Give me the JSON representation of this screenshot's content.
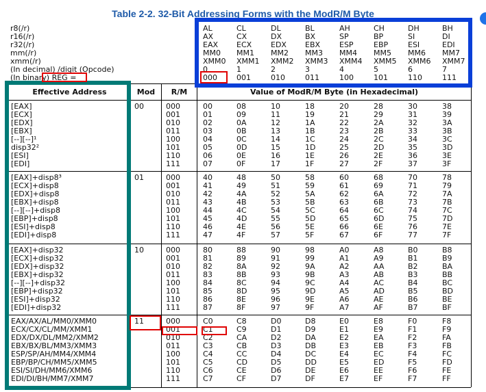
{
  "title": "Table 2-2.  32-Bit Addressing Forms with the ModR/M Byte",
  "left_labels": [
    "r8(/r)",
    "r16(/r)",
    "r32(/r)",
    "mm(/r)",
    "xmm(/r)",
    "(In decimal) /digit (Opcode)",
    "(In binary) REG ="
  ],
  "reg_columns": [
    [
      "AL",
      "AX",
      "EAX",
      "MM0",
      "XMM0",
      "0",
      "000"
    ],
    [
      "CL",
      "CX",
      "ECX",
      "MM1",
      "XMM1",
      "1",
      "001"
    ],
    [
      "DL",
      "DX",
      "EDX",
      "MM2",
      "XMM2",
      "2",
      "010"
    ],
    [
      "BL",
      "BX",
      "EBX",
      "MM3",
      "XMM3",
      "3",
      "011"
    ],
    [
      "AH",
      "SP",
      "ESP",
      "MM4",
      "XMM4",
      "4",
      "100"
    ],
    [
      "CH",
      "BP",
      "EBP",
      "MM5",
      "XMM5",
      "5",
      "101"
    ],
    [
      "DH",
      "SI",
      "ESI",
      "MM6",
      "XMM6",
      "6",
      "110"
    ],
    [
      "BH",
      "DI",
      "EDI",
      "MM7",
      "XMM7",
      "7",
      "111"
    ]
  ],
  "headers": {
    "ea": "Effective Address",
    "mod": "Mod",
    "rm": "R/M",
    "value": "Value of ModR/M Byte (in Hexadecimal)"
  },
  "rm_values": [
    "000",
    "001",
    "010",
    "011",
    "100",
    "101",
    "110",
    "111"
  ],
  "groups": [
    {
      "mod": "00",
      "ea": [
        "[EAX]",
        "[ECX]",
        "[EDX]",
        "[EBX]",
        "[--][--]¹",
        "disp32²",
        "[ESI]",
        "[EDI]"
      ],
      "cols": [
        [
          "00",
          "01",
          "02",
          "03",
          "04",
          "05",
          "06",
          "07"
        ],
        [
          "08",
          "09",
          "0A",
          "0B",
          "0C",
          "0D",
          "0E",
          "0F"
        ],
        [
          "10",
          "11",
          "12",
          "13",
          "14",
          "15",
          "16",
          "17"
        ],
        [
          "18",
          "19",
          "1A",
          "1B",
          "1C",
          "1D",
          "1E",
          "1F"
        ],
        [
          "20",
          "21",
          "22",
          "23",
          "24",
          "25",
          "26",
          "27"
        ],
        [
          "28",
          "29",
          "2A",
          "2B",
          "2C",
          "2D",
          "2E",
          "2F"
        ],
        [
          "30",
          "31",
          "32",
          "33",
          "34",
          "35",
          "36",
          "37"
        ],
        [
          "38",
          "39",
          "3A",
          "3B",
          "3C",
          "3D",
          "3E",
          "3F"
        ]
      ]
    },
    {
      "mod": "01",
      "ea": [
        "[EAX]+disp8³",
        "[ECX]+disp8",
        "[EDX]+disp8",
        "[EBX]+disp8",
        "[--][--]+disp8",
        "[EBP]+disp8",
        "[ESI]+disp8",
        "[EDI]+disp8"
      ],
      "cols": [
        [
          "40",
          "41",
          "42",
          "43",
          "44",
          "45",
          "46",
          "47"
        ],
        [
          "48",
          "49",
          "4A",
          "4B",
          "4C",
          "4D",
          "4E",
          "4F"
        ],
        [
          "50",
          "51",
          "52",
          "53",
          "54",
          "55",
          "56",
          "57"
        ],
        [
          "58",
          "59",
          "5A",
          "5B",
          "5C",
          "5D",
          "5E",
          "5F"
        ],
        [
          "60",
          "61",
          "62",
          "63",
          "64",
          "65",
          "66",
          "67"
        ],
        [
          "68",
          "69",
          "6A",
          "6B",
          "6C",
          "6D",
          "6E",
          "6F"
        ],
        [
          "70",
          "71",
          "72",
          "73",
          "74",
          "75",
          "76",
          "77"
        ],
        [
          "78",
          "79",
          "7A",
          "7B",
          "7C",
          "7D",
          "7E",
          "7F"
        ]
      ]
    },
    {
      "mod": "10",
      "ea": [
        "[EAX]+disp32",
        "[ECX]+disp32",
        "[EDX]+disp32",
        "[EBX]+disp32",
        "[--][--]+disp32",
        "[EBP]+disp32",
        "[ESI]+disp32",
        "[EDI]+disp32"
      ],
      "cols": [
        [
          "80",
          "81",
          "82",
          "83",
          "84",
          "85",
          "86",
          "87"
        ],
        [
          "88",
          "89",
          "8A",
          "8B",
          "8C",
          "8D",
          "8E",
          "8F"
        ],
        [
          "90",
          "91",
          "92",
          "93",
          "94",
          "95",
          "96",
          "97"
        ],
        [
          "98",
          "99",
          "9A",
          "9B",
          "9C",
          "9D",
          "9E",
          "9F"
        ],
        [
          "A0",
          "A1",
          "A2",
          "A3",
          "A4",
          "A5",
          "A6",
          "A7"
        ],
        [
          "A8",
          "A9",
          "AA",
          "AB",
          "AC",
          "AD",
          "AE",
          "AF"
        ],
        [
          "B0",
          "B1",
          "B2",
          "B3",
          "B4",
          "B5",
          "B6",
          "B7"
        ],
        [
          "B8",
          "B9",
          "BA",
          "BB",
          "BC",
          "BD",
          "BE",
          "BF"
        ]
      ]
    },
    {
      "mod": "11",
      "ea": [
        "EAX/AX/AL/MM0/XMM0",
        "ECX/CX/CL/MM/XMM1",
        "EDX/DX/DL/MM2/XMM2",
        "EBX/BX/BL/MM3/XMM3",
        "ESP/SP/AH/MM4/XMM4",
        "EBP/BP/CH/MM5/XMM5",
        "ESI/SI/DH/MM6/XMM6",
        "EDI/DI/BH/MM7/XMM7"
      ],
      "cols": [
        [
          "C0",
          "C1",
          "C2",
          "C3",
          "C4",
          "C5",
          "C6",
          "C7"
        ],
        [
          "C8",
          "C9",
          "CA",
          "CB",
          "CC",
          "CD",
          "CE",
          "CF"
        ],
        [
          "D0",
          "D1",
          "D2",
          "D3",
          "D4",
          "D5",
          "D6",
          "D7"
        ],
        [
          "D8",
          "D9",
          "DA",
          "DB",
          "DC",
          "DD",
          "DE",
          "DF"
        ],
        [
          "E0",
          "E1",
          "E2",
          "E3",
          "E4",
          "E5",
          "E6",
          "E7"
        ],
        [
          "E8",
          "E9",
          "EA",
          "EB",
          "EC",
          "ED",
          "EE",
          "EF"
        ],
        [
          "F0",
          "F1",
          "F2",
          "F3",
          "F4",
          "F5",
          "F6",
          "F7"
        ],
        [
          "F8",
          "F9",
          "FA",
          "FB",
          "FC",
          "FD",
          "FE",
          "FF"
        ]
      ]
    }
  ],
  "highlight_colors": {
    "red": "#e00000",
    "blue": "#0a3fd8",
    "teal": "#007a76"
  }
}
